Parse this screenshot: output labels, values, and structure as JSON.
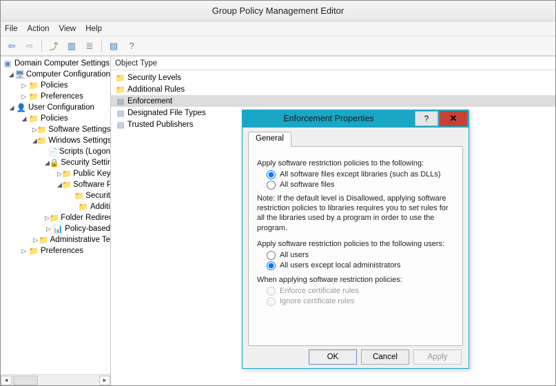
{
  "window": {
    "title": "Group Policy Management Editor"
  },
  "menu": {
    "file": "File",
    "action": "Action",
    "view": "View",
    "help": "Help"
  },
  "toolbar": {
    "back_tip": "Back",
    "forward_tip": "Forward",
    "up_tip": "Up",
    "show_tip": "Show/Hide Console Tree",
    "export_tip": "Export List",
    "refresh_tip": "Refresh",
    "help_tip": "Help",
    "prop_tip": "Properties"
  },
  "tree": {
    "root": "Domain Computer Settings",
    "cc": "Computer Configuration",
    "cc_policies": "Policies",
    "cc_prefs": "Preferences",
    "uc": "User Configuration",
    "uc_policies": "Policies",
    "softset": "Software Settings",
    "winset": "Windows Settings",
    "scripts": "Scripts (Logon",
    "secset": "Security Settin",
    "pubkey": "Public Key",
    "softpol": "Software Po",
    "securit": "Securit",
    "additi": "Additi",
    "folder_redir": "Folder Redirec",
    "policy_based": "Policy-based",
    "admin_tpl": "Administrative Te",
    "uc_prefs": "Preferences"
  },
  "list": {
    "header": "Object Type",
    "items": [
      {
        "icon": "folder",
        "label": "Security Levels"
      },
      {
        "icon": "folder",
        "label": "Additional Rules"
      },
      {
        "icon": "obj",
        "label": "Enforcement",
        "selected": true
      },
      {
        "icon": "obj",
        "label": "Designated File Types"
      },
      {
        "icon": "obj",
        "label": "Trusted Publishers"
      }
    ]
  },
  "dialog": {
    "title": "Enforcement Properties",
    "help": "?",
    "close": "✕",
    "tab_general": "General",
    "apply_label": "Apply software restriction policies to the following:",
    "opt_files_except_libs": "All software files except libraries (such as DLLs)",
    "opt_all_files": "All software files",
    "note": "Note:  If the default level is Disallowed, applying software restriction policies to libraries requires you to set rules for all the libraries used by a program in order to use the program.",
    "users_label": "Apply software restriction policies to the following users:",
    "opt_all_users": "All users",
    "opt_users_except_admins": "All users except local administrators",
    "cert_label": "When applying software restriction policies:",
    "opt_enforce_cert": "Enforce certificate rules",
    "opt_ignore_cert": "Ignore certificate rules",
    "btn_ok": "OK",
    "btn_cancel": "Cancel",
    "btn_apply": "Apply"
  }
}
